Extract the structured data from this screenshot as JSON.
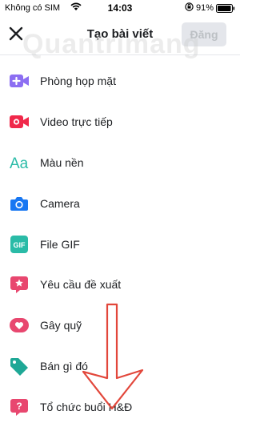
{
  "status_bar": {
    "carrier": "Không có SIM",
    "time": "14:03",
    "battery": "91%"
  },
  "header": {
    "title": "Tạo bài viết",
    "post_label": "Đăng"
  },
  "menu": [
    {
      "label": "Phòng họp mặt",
      "icon": "video-plus-icon"
    },
    {
      "label": "Video trực tiếp",
      "icon": "live-video-icon"
    },
    {
      "label": "Màu nền",
      "icon": "text-color-icon"
    },
    {
      "label": "Camera",
      "icon": "camera-icon"
    },
    {
      "label": "File GIF",
      "icon": "gif-icon"
    },
    {
      "label": "Yêu cầu đề xuất",
      "icon": "star-speech-icon"
    },
    {
      "label": "Gây quỹ",
      "icon": "fundraiser-heart-icon"
    },
    {
      "label": "Bán gì đó",
      "icon": "price-tag-icon"
    },
    {
      "label": "Tổ chức buổi H&Đ",
      "icon": "qa-icon"
    }
  ],
  "colors": {
    "video_purple": "#8c6ef2",
    "live_red": "#f0284a",
    "teal": "#2abba7",
    "blue": "#1877f2",
    "pink": "#e8476f",
    "tag_teal": "#1ea896",
    "arrow_red": "#e2473b"
  }
}
